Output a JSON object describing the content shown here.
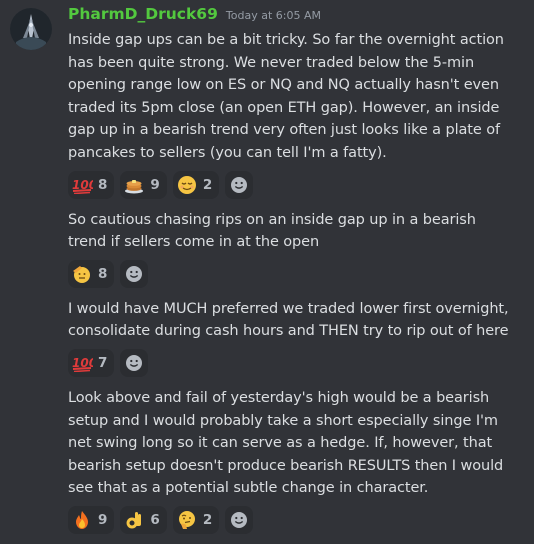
{
  "author": {
    "username": "PharmD_Druck69",
    "timestamp": "Today at 6:05 AM",
    "name_color": "#53c93f"
  },
  "messages": [
    {
      "text": "Inside gap ups can be a bit tricky. So far the overnight action has been quite strong. We never traded below the 5-min opening range low on ES or NQ and NQ actually hasn't even traded its 5pm close (an open ETH gap). However, an inside gap up in a bearish trend very often just looks like a plate of pancakes to sellers (you can tell I'm a fatty).",
      "reactions": [
        {
          "emoji": "hundred-points",
          "count": "8"
        },
        {
          "emoji": "pancakes",
          "count": "9"
        },
        {
          "emoji": "relieved-face",
          "count": "2"
        }
      ]
    },
    {
      "text": "So cautious chasing rips on an inside gap up in a bearish trend if sellers come in at the open",
      "reactions": [
        {
          "emoji": "saluting-face",
          "count": "8"
        }
      ]
    },
    {
      "text": "I would have MUCH preferred we traded lower first overnight, consolidate during cash hours and THEN try to rip out of here",
      "reactions": [
        {
          "emoji": "hundred-points",
          "count": "7"
        }
      ]
    },
    {
      "text": "Look above and fail of yesterday's high would be a bearish setup and I would probably take a short especially singe I'm net swing long so it can serve as a hedge. If, however, that bearish setup doesn't produce bearish RESULTS then I would see that as a potential subtle change in character.",
      "reactions": [
        {
          "emoji": "fire",
          "count": "9"
        },
        {
          "emoji": "ok-hand",
          "count": "6"
        },
        {
          "emoji": "thinking-face",
          "count": "2"
        }
      ]
    }
  ],
  "colors": {
    "background": "#313338",
    "reaction_bg": "#2b2d31",
    "text": "#dbdee1",
    "muted": "#949ba4"
  }
}
